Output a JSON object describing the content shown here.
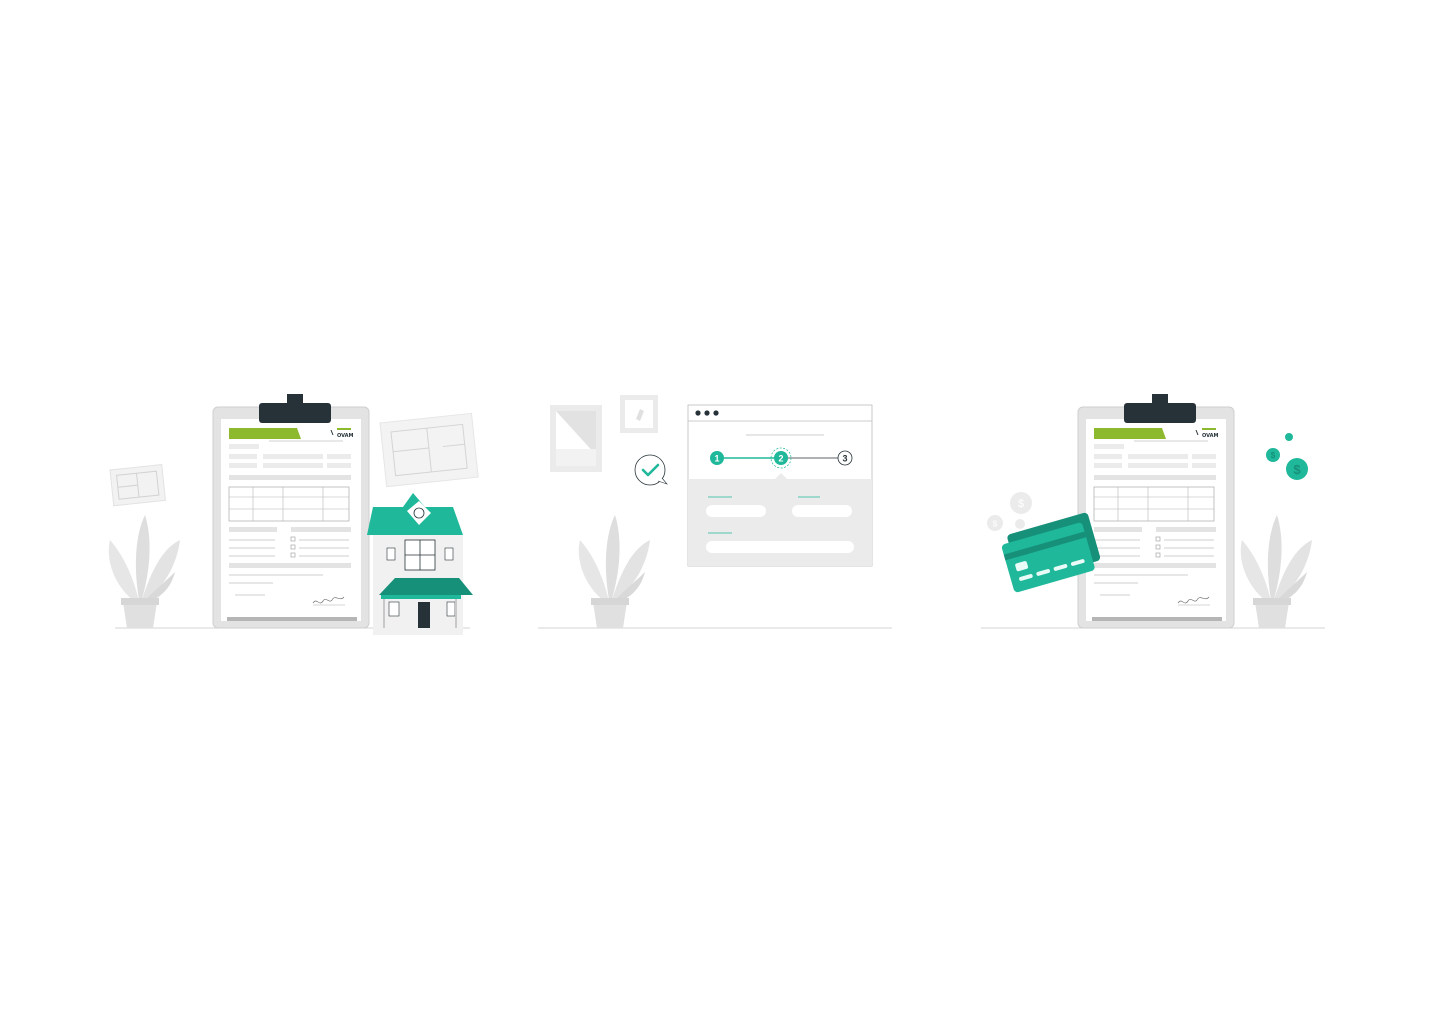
{
  "colors": {
    "teal": "#1fb89a",
    "teal_dark": "#17907a",
    "lime": "#8db92e",
    "dark": "#263238",
    "grey_light": "#ebebeb",
    "grey_mid": "#d9d9d9",
    "line": "#cfcfcf"
  },
  "left_panel": {
    "document": {
      "logo_text": "OVAM"
    }
  },
  "middle_panel": {
    "window_dots": 3,
    "steps": [
      {
        "label": "1",
        "state": "done"
      },
      {
        "label": "2",
        "state": "active"
      },
      {
        "label": "3",
        "state": "pending"
      }
    ]
  },
  "right_panel": {
    "document": {
      "logo_text": "OVAM"
    },
    "coins": [
      "$",
      "$",
      "$"
    ]
  },
  "icons": [
    "clipboard-icon",
    "house-icon",
    "plant-icon",
    "floorplan-icon",
    "checkmark-icon",
    "credit-card-icon",
    "coin-icon",
    "picture-frame-icon"
  ]
}
